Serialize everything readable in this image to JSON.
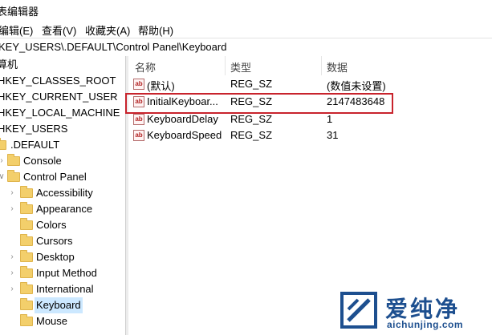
{
  "window": {
    "title": "表编辑器"
  },
  "menu": [
    {
      "label": "编辑(E)"
    },
    {
      "label": "查看(V)"
    },
    {
      "label": "收藏夹(A)"
    },
    {
      "label": "帮助(H)"
    }
  ],
  "address": {
    "path": "KEY_USERS\\.DEFAULT\\Control Panel\\Keyboard"
  },
  "tree": {
    "root_label": "算机",
    "items": [
      {
        "label": "HKEY_CLASSES_ROOT"
      },
      {
        "label": "HKEY_CURRENT_USER"
      },
      {
        "label": "HKEY_LOCAL_MACHINE"
      },
      {
        "label": "HKEY_USERS"
      },
      {
        "label": ".DEFAULT"
      },
      {
        "label": "Console"
      },
      {
        "label": "Control Panel"
      },
      {
        "label": "Accessibility"
      },
      {
        "label": "Appearance"
      },
      {
        "label": "Colors"
      },
      {
        "label": "Cursors"
      },
      {
        "label": "Desktop"
      },
      {
        "label": "Input Method"
      },
      {
        "label": "International"
      },
      {
        "label": "Keyboard"
      },
      {
        "label": "Mouse"
      }
    ]
  },
  "columns": {
    "name": "名称",
    "type": "类型",
    "data": "数据"
  },
  "values": [
    {
      "name": "(默认)",
      "type": "REG_SZ",
      "data": "(数值未设置)"
    },
    {
      "name": "InitialKeyboar...",
      "type": "REG_SZ",
      "data": "2147483648"
    },
    {
      "name": "KeyboardDelay",
      "type": "REG_SZ",
      "data": "1"
    },
    {
      "name": "KeyboardSpeed",
      "type": "REG_SZ",
      "data": "31"
    }
  ],
  "icons": {
    "string_value": "ab"
  },
  "watermark": {
    "text": "爱纯净",
    "url": "aichunjing.com"
  },
  "colors": {
    "selection": "#cce8ff",
    "highlight_border": "#c8232c",
    "folder": "#f3cf6b",
    "watermark": "#1d4f8f"
  }
}
